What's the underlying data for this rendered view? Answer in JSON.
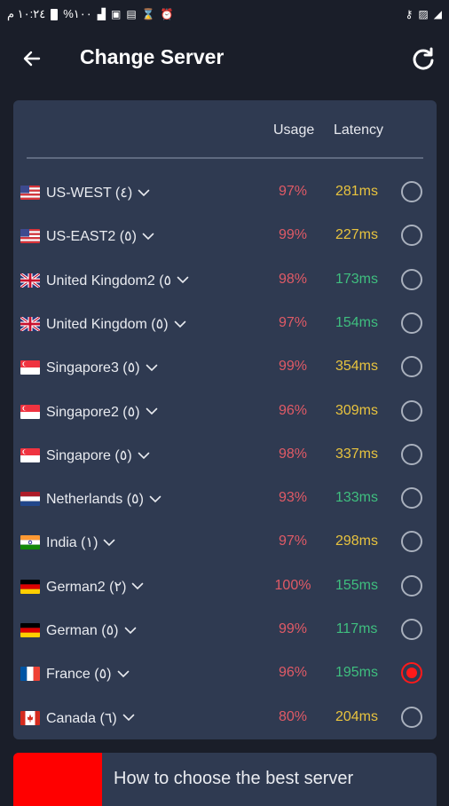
{
  "status_bar": {
    "time": "١٠:٢٤ م",
    "battery": "%١٠٠"
  },
  "app_bar": {
    "title": "Change Server"
  },
  "list": {
    "usage_header": "Usage",
    "latency_header": "Latency",
    "servers": [
      {
        "flag": "us",
        "name": "US-WEST (٤)",
        "usage": "97%",
        "latency": "281ms",
        "latency_color": "yellow",
        "selected": false
      },
      {
        "flag": "us",
        "name": "US-EAST2 (٥)",
        "usage": "99%",
        "latency": "227ms",
        "latency_color": "yellow",
        "selected": false
      },
      {
        "flag": "uk",
        "name": "United Kingdom2 (٥",
        "usage": "98%",
        "latency": "173ms",
        "latency_color": "green",
        "selected": false
      },
      {
        "flag": "uk",
        "name": "United Kingdom (٥)",
        "usage": "97%",
        "latency": "154ms",
        "latency_color": "green",
        "selected": false
      },
      {
        "flag": "sg",
        "name": "Singapore3 (٥)",
        "usage": "99%",
        "latency": "354ms",
        "latency_color": "yellow",
        "selected": false
      },
      {
        "flag": "sg",
        "name": "Singapore2 (٥)",
        "usage": "96%",
        "latency": "309ms",
        "latency_color": "yellow",
        "selected": false
      },
      {
        "flag": "sg",
        "name": "Singapore (٥)",
        "usage": "98%",
        "latency": "337ms",
        "latency_color": "yellow",
        "selected": false
      },
      {
        "flag": "nl",
        "name": "Netherlands (٥)",
        "usage": "93%",
        "latency": "133ms",
        "latency_color": "green",
        "selected": false
      },
      {
        "flag": "in",
        "name": "India (١)",
        "usage": "97%",
        "latency": "298ms",
        "latency_color": "yellow",
        "selected": false
      },
      {
        "flag": "de",
        "name": "German2 (٢)",
        "usage": "100%",
        "latency": "155ms",
        "latency_color": "green",
        "selected": false
      },
      {
        "flag": "de",
        "name": "German (٥)",
        "usage": "99%",
        "latency": "117ms",
        "latency_color": "green",
        "selected": false
      },
      {
        "flag": "fr",
        "name": "France (٥)",
        "usage": "96%",
        "latency": "195ms",
        "latency_color": "green",
        "selected": true
      },
      {
        "flag": "ca",
        "name": "Canada (٦)",
        "usage": "80%",
        "latency": "204ms",
        "latency_color": "yellow",
        "selected": false
      }
    ]
  },
  "banner": {
    "text": "How to choose the best server"
  }
}
